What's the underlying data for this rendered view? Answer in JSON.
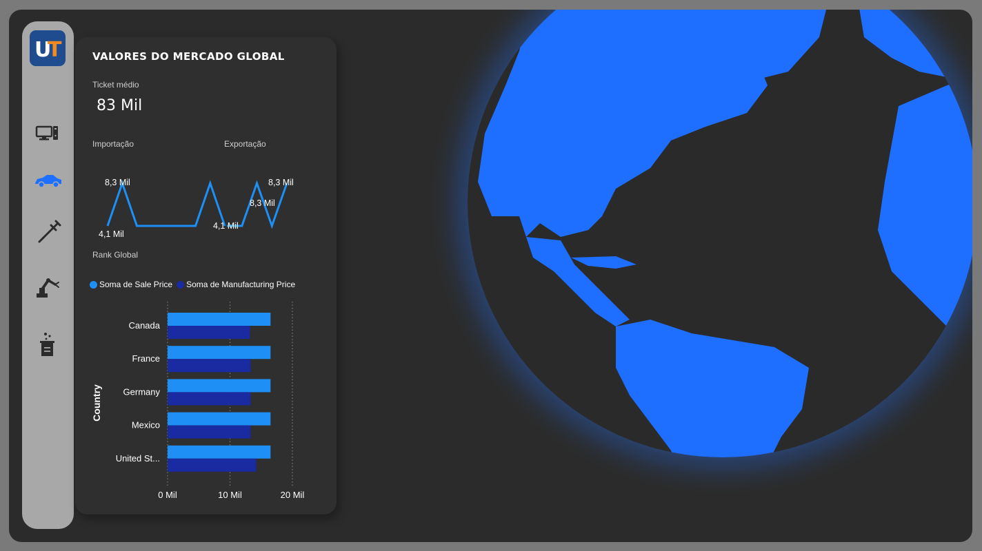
{
  "panel": {
    "title": "VALORES DO MERCADO GLOBAL",
    "kpi": {
      "label": "Ticket médio",
      "value": "83 Mil"
    },
    "importacao": {
      "label": "Importação",
      "max_label": "8,3 Mil",
      "min_label": "4,1 Mil",
      "values": [
        4.1,
        8.3,
        4.1,
        4.1,
        4.1,
        4.1,
        4.1,
        8.3,
        4.1
      ]
    },
    "exportacao": {
      "label": "Exportação",
      "max_label": "8,3 Mil",
      "mid_label": "8,3 Mil",
      "min_label": "4,1 Mil",
      "values": [
        4.1,
        4.1,
        8.3,
        4.1,
        8.3
      ]
    },
    "rank": {
      "label": "Rank Global"
    }
  },
  "sidebar": {
    "logo_text": "UT",
    "items": [
      {
        "icon": "computer-icon"
      },
      {
        "icon": "car-icon",
        "active": true
      },
      {
        "icon": "syringe-icon"
      },
      {
        "icon": "robot-arm-icon"
      },
      {
        "icon": "beaker-icon"
      }
    ]
  },
  "chart_data": {
    "type": "bar",
    "orientation": "horizontal",
    "title": "",
    "ylabel": "Country",
    "xlabel": "",
    "categories": [
      "Canada",
      "France",
      "Germany",
      "Mexico",
      "United St..."
    ],
    "series": [
      {
        "name": "Soma de Sale Price",
        "color": "#1e8ff5",
        "values": [
          16.5,
          16.5,
          16.5,
          16.5,
          16.5
        ]
      },
      {
        "name": "Soma de Manufacturing Price",
        "color": "#1a2aa0",
        "values": [
          13.2,
          13.3,
          13.3,
          13.3,
          14.2
        ]
      }
    ],
    "xlim": [
      0,
      20
    ],
    "xticks": [
      0,
      10,
      20
    ],
    "xtick_labels": [
      "0 Mil",
      "10 Mil",
      "20 Mil"
    ],
    "grid": "vertical dotted",
    "legend": "top-left"
  },
  "colors": {
    "accent": "#1e6fff",
    "background": "#2b2b2b",
    "panel": "#2f2f2f",
    "sidebar": "#a8a8a8"
  }
}
